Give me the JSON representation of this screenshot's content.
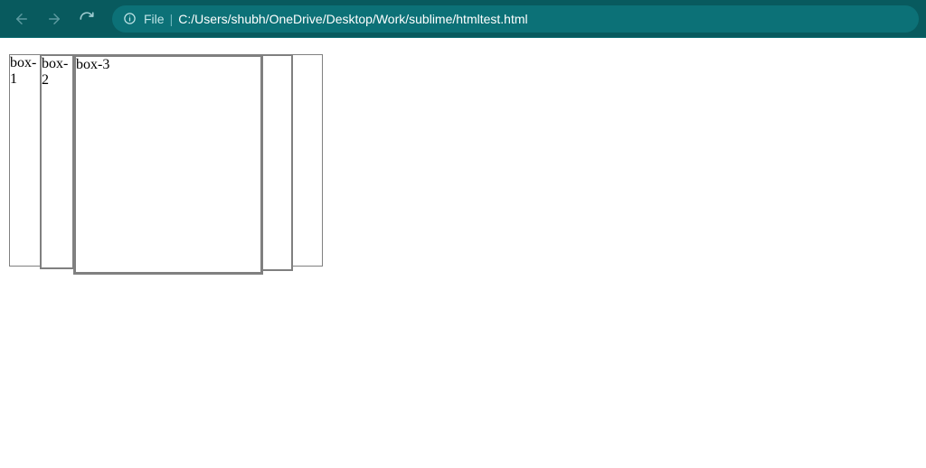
{
  "toolbar": {
    "url_prefix": "File",
    "url_path": "C:/Users/shubh/OneDrive/Desktop/Work/sublime/htmltest.html"
  },
  "page": {
    "boxes": [
      {
        "label": "box-1"
      },
      {
        "label": "box-2"
      },
      {
        "label": "box-3"
      },
      {
        "label": ""
      },
      {
        "label": ""
      }
    ]
  }
}
